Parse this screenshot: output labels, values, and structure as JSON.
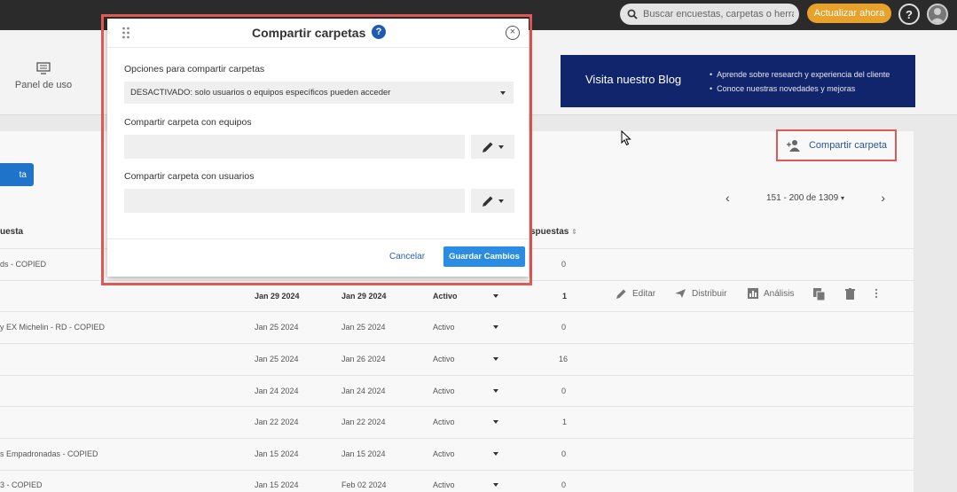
{
  "topbar": {
    "search_placeholder": "Buscar encuestas, carpetas o herrami",
    "upgrade_label": "Actualizar ahora",
    "help_label": "?"
  },
  "nav": {
    "usage_panel": "Panel de uso"
  },
  "blog": {
    "title": "Visita nuestro Blog",
    "bullets": [
      "Aprende sobre research y experiencia del cliente",
      "Conoce nuestras novedades y mejoras"
    ]
  },
  "toolbar": {
    "left_button_label": "ta",
    "share_folder_label": "Compartir carpeta"
  },
  "pager": {
    "range": "151 - 200 de 1309"
  },
  "table": {
    "headers": {
      "name": "uesta",
      "responses": "spuestas"
    },
    "rows": [
      {
        "name": "ds - COPIED",
        "created": "",
        "modified": "",
        "status": "",
        "responses": "0"
      },
      {
        "name": "",
        "created": "Jan 29 2024",
        "modified": "Jan 29 2024",
        "status": "Activo",
        "responses": "1"
      },
      {
        "name": "y EX Michelin - RD - COPIED",
        "created": "Jan 25 2024",
        "modified": "Jan 25 2024",
        "status": "Activo",
        "responses": "0"
      },
      {
        "name": "",
        "created": "Jan 25 2024",
        "modified": "Jan 26 2024",
        "status": "Activo",
        "responses": "16"
      },
      {
        "name": "",
        "created": "Jan 24 2024",
        "modified": "Jan 24 2024",
        "status": "Activo",
        "responses": "0"
      },
      {
        "name": "",
        "created": "Jan 22 2024",
        "modified": "Jan 22 2024",
        "status": "Activo",
        "responses": "1"
      },
      {
        "name": "s Empadronadas - COPIED",
        "created": "Jan 15 2024",
        "modified": "Jan 15 2024",
        "status": "Activo",
        "responses": "0"
      },
      {
        "name": "3 - COPIED",
        "created": "Jan 15 2024",
        "modified": "Feb 02 2024",
        "status": "Activo",
        "responses": "0"
      }
    ],
    "row_actions": {
      "edit": "Editar",
      "distribute": "Distribuir",
      "analysis": "Análisis"
    }
  },
  "modal": {
    "title": "Compartir carpetas",
    "help_label": "?",
    "close_label": "×",
    "options_label": "Opciones para compartir carpetas",
    "options_value": "DESACTIVADO: solo usuarios o equipos específicos pueden acceder",
    "teams_label": "Compartir carpeta con equipos",
    "users_label": "Compartir carpeta con usuarios",
    "cancel_label": "Cancelar",
    "save_label": "Guardar Cambios"
  }
}
